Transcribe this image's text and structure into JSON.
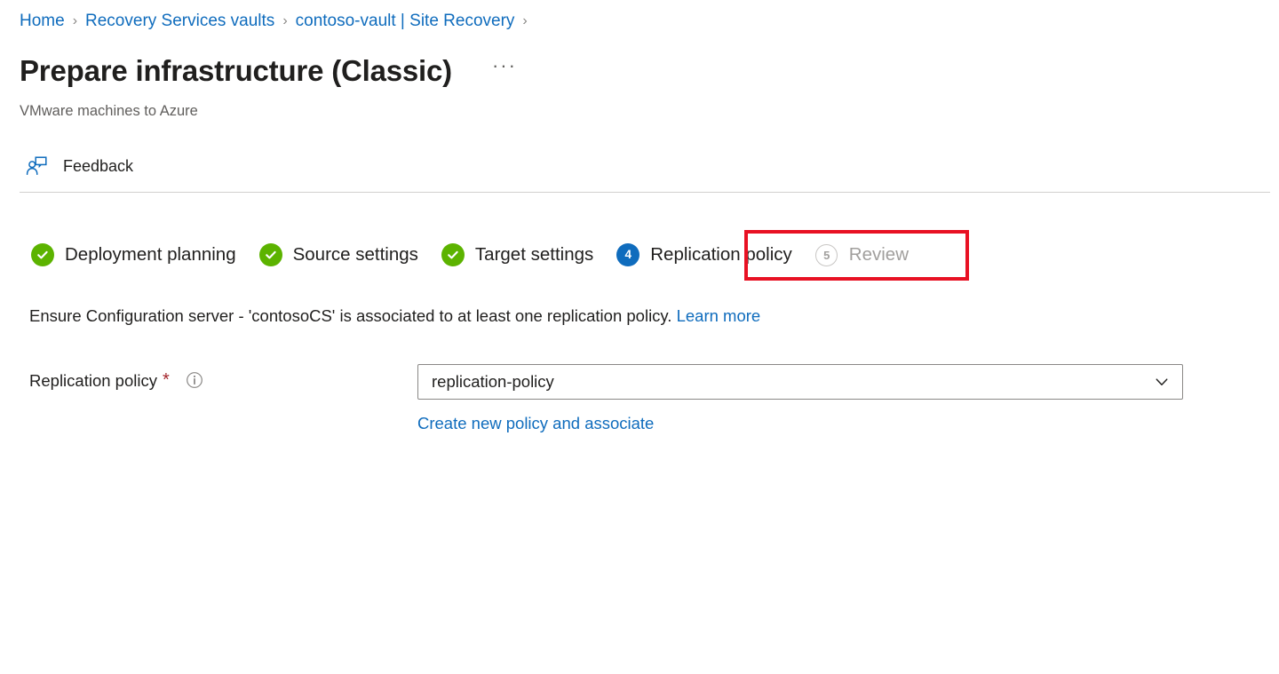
{
  "breadcrumb": {
    "separator": "›",
    "items": [
      {
        "label": "Home"
      },
      {
        "label": "Recovery Services vaults"
      },
      {
        "label": "contoso-vault | Site Recovery"
      }
    ]
  },
  "header": {
    "title": "Prepare infrastructure (Classic)",
    "more_label": "···",
    "subtitle": "VMware machines to Azure"
  },
  "commandbar": {
    "feedback_label": "Feedback",
    "feedback_icon": "feedback-person-comment-icon"
  },
  "wizard": {
    "steps": [
      {
        "number": "1",
        "label": "Deployment planning",
        "state": "completed",
        "icon": "check-circle-icon"
      },
      {
        "number": "2",
        "label": "Source settings",
        "state": "completed",
        "icon": "check-circle-icon"
      },
      {
        "number": "3",
        "label": "Target settings",
        "state": "completed",
        "icon": "check-circle-icon"
      },
      {
        "number": "4",
        "label": "Replication policy",
        "state": "active",
        "icon": "step-number-circle-icon"
      },
      {
        "number": "5",
        "label": "Review",
        "state": "pending",
        "icon": "step-number-circle-icon"
      }
    ],
    "highlight_step": "Replication policy"
  },
  "content": {
    "description_text": "Ensure Configuration server - 'contosoCS' is associated to at least one replication policy.",
    "description_link": "Learn more"
  },
  "form": {
    "field_label": "Replication policy",
    "required_marker": "*",
    "info_icon": "info-circle-icon",
    "dropdown": {
      "value": "replication-policy",
      "placeholder": "replication-policy",
      "chevron_icon": "chevron-down-icon",
      "options": [
        "replication-policy"
      ]
    },
    "create_link": "Create new policy and associate"
  },
  "colors": {
    "link": "#0f6cbd",
    "completed": "#5cb300",
    "active": "#0f6cbd",
    "pending": "#a19f9d",
    "required": "#a4262c",
    "highlight": "#e81123"
  }
}
